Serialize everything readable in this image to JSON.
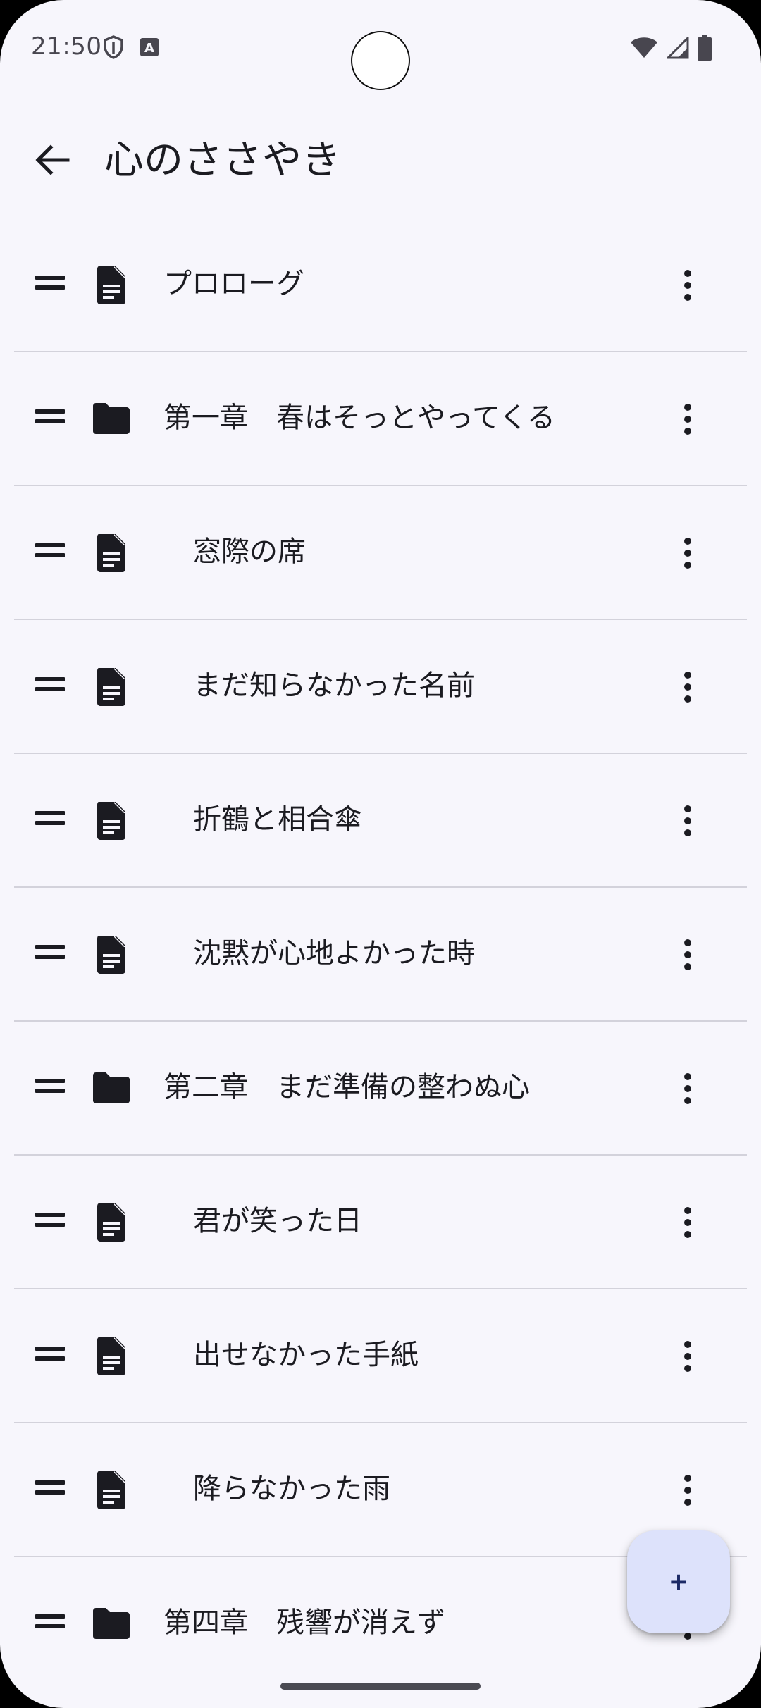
{
  "status_bar": {
    "time": "21:50",
    "left_icons": [
      "shield-icon",
      "keyboard-a-icon"
    ],
    "right_icons": [
      "wifi-icon",
      "signal-icon",
      "battery-icon"
    ]
  },
  "app_bar": {
    "back_icon": "arrow-back-icon",
    "title": "心のささやき"
  },
  "items": [
    {
      "type": "document",
      "label": "プロローグ",
      "level": "top"
    },
    {
      "type": "folder",
      "label": "第一章　春はそっとやってくる",
      "level": "folder"
    },
    {
      "type": "document",
      "label": "窓際の席",
      "level": "child"
    },
    {
      "type": "document",
      "label": "まだ知らなかった名前",
      "level": "child"
    },
    {
      "type": "document",
      "label": "折鶴と相合傘",
      "level": "child"
    },
    {
      "type": "document",
      "label": "沈黙が心地よかった時",
      "level": "child"
    },
    {
      "type": "folder",
      "label": "第二章　まだ準備の整わぬ心",
      "level": "folder"
    },
    {
      "type": "document",
      "label": "君が笑った日",
      "level": "child"
    },
    {
      "type": "document",
      "label": "出せなかった手紙",
      "level": "child"
    },
    {
      "type": "document",
      "label": "降らなかった雨",
      "level": "child"
    },
    {
      "type": "folder",
      "label": "第四章　残響が消えず",
      "level": "folder"
    }
  ],
  "fab": {
    "label": "+"
  },
  "colors": {
    "background": "#f7f6fc",
    "text": "#1b1b21",
    "divider": "#d3d2db",
    "fab_background": "#dde2fb",
    "fab_text": "#1c2a66"
  }
}
